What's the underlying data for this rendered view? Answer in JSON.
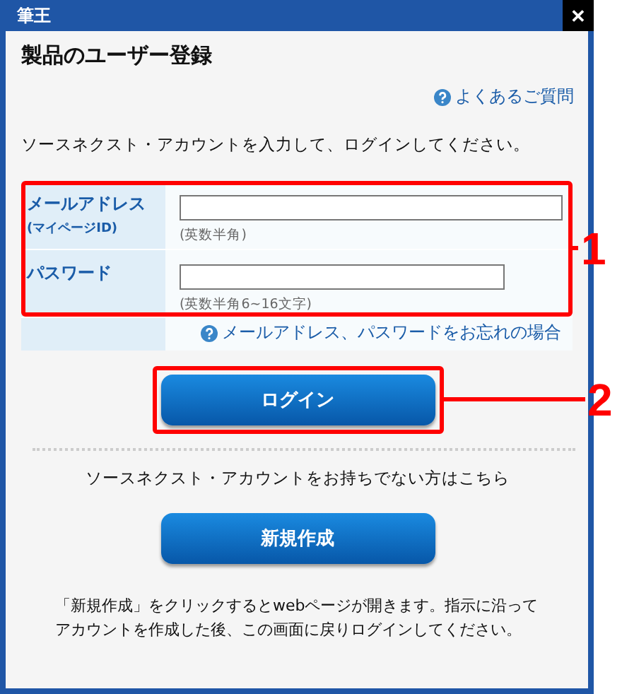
{
  "window": {
    "title": "筆王",
    "close": "✕"
  },
  "heading": "製品のユーザー登録",
  "faq_link": "よくあるご質問",
  "instruction": "ソースネクスト・アカウントを入力して、ログインしてください。",
  "fields": [
    {
      "label": "メールアドレス",
      "sublabel": "(マイページID)",
      "hint": "(英数半角)",
      "kind": "wide"
    },
    {
      "label": "パスワード",
      "hint": "(英数半角6~16文字)",
      "kind": "narrow"
    }
  ],
  "forgot_link": "メールアドレス、パスワードをお忘れの場合",
  "login_button": "ログイン",
  "no_account_text": "ソースネクスト・アカウントをお持ちでない方はこちら",
  "create_button": "新規作成",
  "note": [
    "「新規作成」をクリックするとwebページが開きます。指示に沿って",
    "アカウントを作成した後、この画面に戻りログインしてください。"
  ],
  "callouts": [
    {
      "label": "1"
    },
    {
      "label": "2"
    }
  ]
}
